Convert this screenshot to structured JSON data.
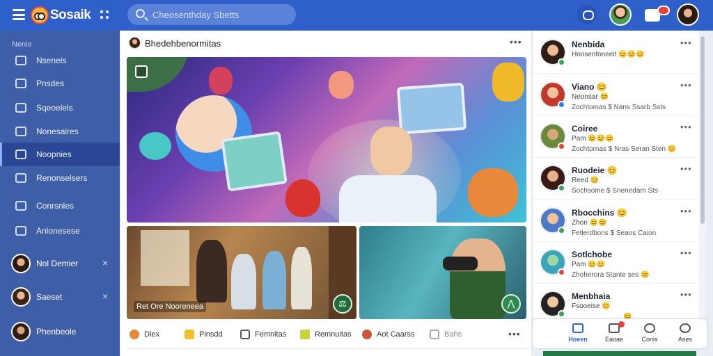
{
  "app": {
    "name": "Sosaik"
  },
  "search": {
    "placeholder": "Cheosenthday Sbetts"
  },
  "sidebar": {
    "header": "Nenie",
    "items": [
      {
        "label": "Nsenels",
        "icon": "people-icon"
      },
      {
        "label": "Pnsdes",
        "icon": "grid-icon"
      },
      {
        "label": "Sqeoelels",
        "icon": "bookmark-icon"
      },
      {
        "label": "Nonesaires",
        "icon": "calendar-icon"
      },
      {
        "label": "Noopnies",
        "icon": "group-icon",
        "active": true
      },
      {
        "label": "Renonselsers",
        "icon": "chat-icon"
      },
      {
        "label": "Conrsnles",
        "icon": "store-icon"
      },
      {
        "label": "Anlonesese",
        "icon": "gift-icon"
      }
    ],
    "contacts": [
      {
        "name": "Nol Demier",
        "close": "×"
      },
      {
        "name": "Saeset",
        "close": "×"
      },
      {
        "name": "Phenbeole"
      }
    ]
  },
  "feed": {
    "author": "Bhedehbenormitas",
    "thumb1_caption": "Ret Ore Nooreneea",
    "actions": [
      {
        "label": "Dlex",
        "icon": "like-icon"
      },
      {
        "label": "Pinsdd",
        "icon": "share-icon"
      },
      {
        "label": "Femnitas",
        "icon": "comment-icon"
      },
      {
        "label": "Remnuitas",
        "icon": "send-icon"
      },
      {
        "label": "Aot Caarss",
        "icon": "profile-icon"
      },
      {
        "label": "Bahs",
        "icon": "save-icon"
      }
    ]
  },
  "right_panel": {
    "items": [
      {
        "name": "Nenbida",
        "line1": "Honsenfoneeit 😊😊😊",
        "line2": "",
        "dot": "#3aa55a"
      },
      {
        "name": "Viano 😊",
        "line1": "Neonsar 😊",
        "line2": "Zochtomas $ Nans Ssarb Ssts",
        "dot": "#2f7de0"
      },
      {
        "name": "Coiree",
        "line1": "Pam 😊😊😊",
        "line2": "Zochtornas $ Nras Seran Sten 😊",
        "dot": "#e8413a"
      },
      {
        "name": "Ruodeie 😊",
        "line1": "Reed 😊",
        "line2": "Sochsome $ Snenedam Sts",
        "dot": "#3aa55a"
      },
      {
        "name": "Rbocchins 😊",
        "line1": "Zhon 😊😊",
        "line2": "Fetlerdbons $ Seaos Caion",
        "dot": "#3aa55a"
      },
      {
        "name": "Sotlchobe",
        "line1": "Pam 😊😊",
        "line2": "Zhoherora Stante ses 😊",
        "dot": "#e8413a"
      },
      {
        "name": "Menbhaia",
        "line1": "Fsooeise 😊",
        "line2": "😊",
        "dot": "#3aa55a"
      }
    ]
  },
  "bottom_nav": [
    {
      "label": "Hoeen",
      "active": true
    },
    {
      "label": "Eaoae"
    },
    {
      "label": "Conis"
    },
    {
      "label": "Ases"
    }
  ],
  "colors": {
    "topbar": "#2f5fc9",
    "sidebar": "#3f5ea8",
    "accent": "#2f5fc9"
  }
}
